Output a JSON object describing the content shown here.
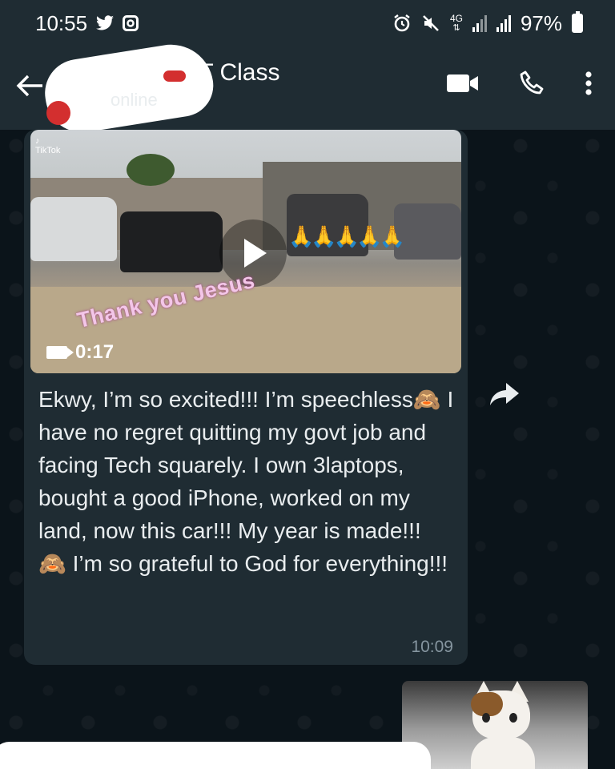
{
  "status_bar": {
    "time": "10:55",
    "network": "4G",
    "battery": "97%"
  },
  "header": {
    "title": "IT Class",
    "subtitle": "online"
  },
  "message": {
    "video_duration": "0:17",
    "video_caption": "Thank you Jesus",
    "text": "Ekwy, I’m so excited!!! I’m speechless🙈 I have no regret quitting my govt job and facing Tech squarely. I own 3laptops, bought a good iPhone, worked on my land, now this car!!! My year is made!!! 🙈 I’m so grateful to God for everything!!!",
    "time": "10:09"
  },
  "colors": {
    "header_bg": "#1f2c33",
    "chat_bg": "#0b141a",
    "bubble_bg": "#1f2c33",
    "timestamp": "#8696a0"
  },
  "icons": [
    "twitter-icon",
    "instagram-icon",
    "alarm-icon",
    "mute-icon",
    "signal-icon",
    "battery-icon",
    "back-arrow-icon",
    "video-call-icon",
    "phone-icon",
    "more-vert-icon",
    "play-icon",
    "video-camera-icon",
    "forward-icon"
  ]
}
